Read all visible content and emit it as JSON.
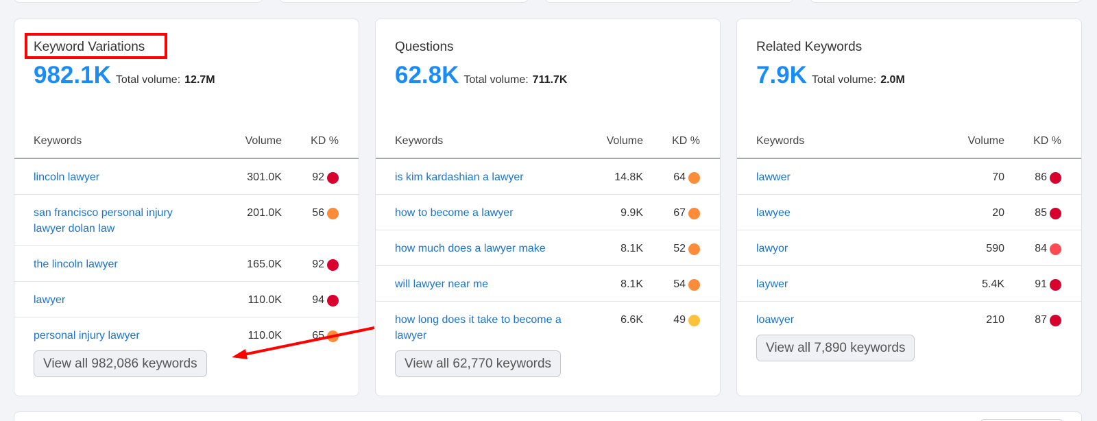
{
  "colors": {
    "accent": "#1a8cf5",
    "link": "#1a73cf",
    "kd_very_hard": "#d7002f",
    "kd_hard": "#ff4953",
    "kd_difficult": "#fd8c3a",
    "kd_possible": "#fdc23c",
    "annotation": "#ff0000"
  },
  "cards": [
    {
      "title": "Keyword Variations",
      "count": "982.1K",
      "total_volume_label": "Total volume:",
      "total_volume": "12.7M",
      "columns": {
        "keyword": "Keywords",
        "volume": "Volume",
        "kd": "KD %"
      },
      "rows": [
        {
          "keyword": "lincoln lawyer",
          "volume": "301.0K",
          "kd": "92",
          "kd_level": "very-hard"
        },
        {
          "keyword": "san francisco personal injury lawyer dolan law",
          "volume": "201.0K",
          "kd": "56",
          "kd_level": "difficult"
        },
        {
          "keyword": "the lincoln lawyer",
          "volume": "165.0K",
          "kd": "92",
          "kd_level": "very-hard"
        },
        {
          "keyword": "lawyer",
          "volume": "110.0K",
          "kd": "94",
          "kd_level": "very-hard"
        },
        {
          "keyword": "personal injury lawyer",
          "volume": "110.0K",
          "kd": "65",
          "kd_level": "difficult"
        }
      ],
      "view_all": "View all 982,086 keywords"
    },
    {
      "title": "Questions",
      "count": "62.8K",
      "total_volume_label": "Total volume:",
      "total_volume": "711.7K",
      "columns": {
        "keyword": "Keywords",
        "volume": "Volume",
        "kd": "KD %"
      },
      "rows": [
        {
          "keyword": "is kim kardashian a lawyer",
          "volume": "14.8K",
          "kd": "64",
          "kd_level": "difficult"
        },
        {
          "keyword": "how to become a lawyer",
          "volume": "9.9K",
          "kd": "67",
          "kd_level": "difficult"
        },
        {
          "keyword": "how much does a lawyer make",
          "volume": "8.1K",
          "kd": "52",
          "kd_level": "difficult"
        },
        {
          "keyword": "will lawyer near me",
          "volume": "8.1K",
          "kd": "54",
          "kd_level": "difficult"
        },
        {
          "keyword": "how long does it take to become a lawyer",
          "volume": "6.6K",
          "kd": "49",
          "kd_level": "possible"
        }
      ],
      "view_all": "View all 62,770 keywords"
    },
    {
      "title": "Related Keywords",
      "count": "7.9K",
      "total_volume_label": "Total volume:",
      "total_volume": "2.0M",
      "columns": {
        "keyword": "Keywords",
        "volume": "Volume",
        "kd": "KD %"
      },
      "rows": [
        {
          "keyword": "lawwer",
          "volume": "70",
          "kd": "86",
          "kd_level": "very-hard"
        },
        {
          "keyword": "lawyee",
          "volume": "20",
          "kd": "85",
          "kd_level": "very-hard"
        },
        {
          "keyword": "lawyor",
          "volume": "590",
          "kd": "84",
          "kd_level": "hard"
        },
        {
          "keyword": "laywer",
          "volume": "5.4K",
          "kd": "91",
          "kd_level": "very-hard"
        },
        {
          "keyword": "loawyer",
          "volume": "210",
          "kd": "87",
          "kd_level": "very-hard"
        }
      ],
      "view_all": "View all 7,890 keywords"
    }
  ]
}
